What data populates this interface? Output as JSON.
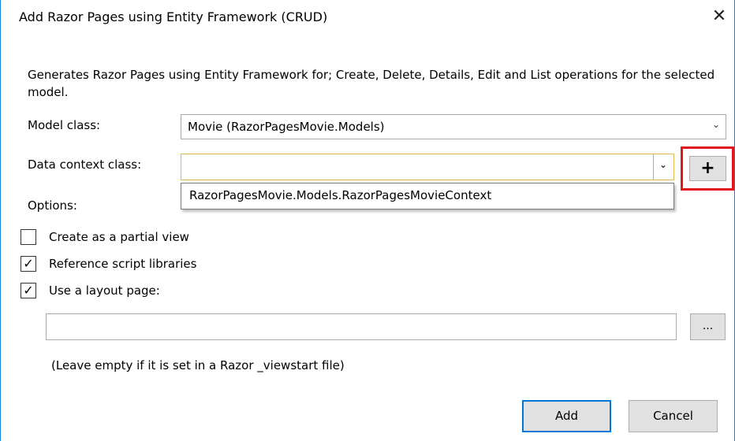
{
  "window": {
    "title": "Add Razor Pages using Entity Framework (CRUD)",
    "close_glyph": "✕"
  },
  "description": "Generates Razor Pages using Entity Framework for; Create, Delete, Details, Edit and List operations for the selected model.",
  "model_class": {
    "label": "Model class:",
    "value": "Movie (RazorPagesMovie.Models)",
    "chevron": "⌄"
  },
  "data_context": {
    "label": "Data context class:",
    "value": "",
    "chevron": "⌄",
    "add_label": "+",
    "dropdown_option": "RazorPagesMovie.Models.RazorPagesMovieContext"
  },
  "options": {
    "label": "Options:",
    "partial_view": {
      "label": "Create as a partial view",
      "checked": false,
      "mark": ""
    },
    "script_libraries": {
      "label": "Reference script libraries",
      "checked": true,
      "mark": "✓"
    },
    "layout_page": {
      "label": "Use a layout page:",
      "checked": true,
      "mark": "✓"
    }
  },
  "layout_path": {
    "value": "",
    "browse_label": "..."
  },
  "hint": "(Leave empty if it is set in a Razor _viewstart file)",
  "buttons": {
    "add": "Add",
    "cancel": "Cancel"
  },
  "colors": {
    "accent": "#0078d7",
    "highlight_border": "#e2141c",
    "focus_border": "#e2b64d"
  }
}
